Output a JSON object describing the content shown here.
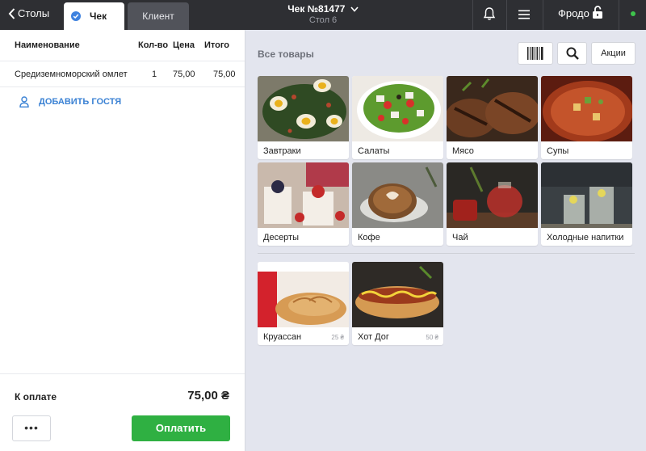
{
  "topbar": {
    "back_label": "Столы",
    "tab_check": "Чек",
    "tab_client": "Клиент",
    "order_title": "Чек №81477",
    "order_subtitle": "Стол 6",
    "user_name": "Фродо",
    "status_color": "#3ec34c"
  },
  "order": {
    "columns": [
      "Наименование",
      "Кол-во",
      "Цена",
      "Итого"
    ],
    "items": [
      {
        "name": "Средиземноморский омлет",
        "qty": "1",
        "price": "75,00",
        "total": "75,00"
      }
    ],
    "add_guest": "ДОБАВИТЬ ГОСТЯ",
    "total_label": "К оплате",
    "total_value": "75,00 ₴",
    "more_label": "•••",
    "pay_label": "Оплатить"
  },
  "catalog": {
    "title": "Все товары",
    "promo_label": "Акции",
    "categories": [
      {
        "label": "Завтраки",
        "icon": "breakfast-photo"
      },
      {
        "label": "Салаты",
        "icon": "salad-photo"
      },
      {
        "label": "Мясо",
        "icon": "meat-photo"
      },
      {
        "label": "Супы",
        "icon": "soup-photo"
      },
      {
        "label": "Десерты",
        "icon": "dessert-photo"
      },
      {
        "label": "Кофе",
        "icon": "coffee-photo"
      },
      {
        "label": "Чай",
        "icon": "tea-photo"
      },
      {
        "label": "Холодные напитки",
        "icon": "cold-drinks-photo"
      }
    ],
    "products": [
      {
        "label": "Круассан",
        "price": "25 ₴",
        "icon": "croissant-photo"
      },
      {
        "label": "Хот Дог",
        "price": "50 ₴",
        "icon": "hotdog-photo"
      }
    ]
  }
}
